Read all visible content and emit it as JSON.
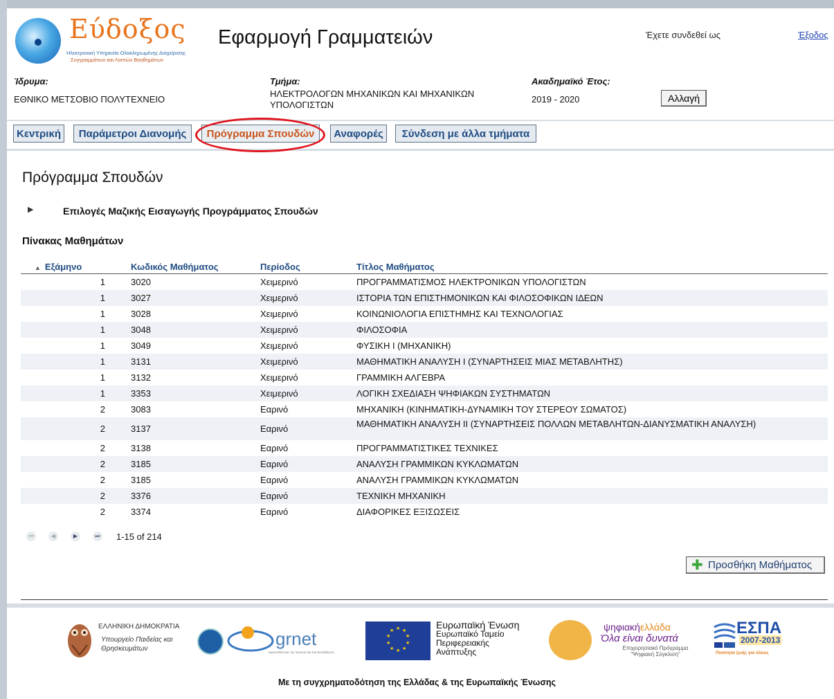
{
  "header": {
    "logo_name": "Εύδοξος",
    "logo_line1": "Ηλεκτρονική Υπηρεσία Ολοκληρωμένης Διαχείρισης",
    "logo_line2": "Συγγραμμάτων και Λοιπών Βοηθημάτων",
    "app_title": "Εφαρμογή Γραμματειών",
    "logged_in_as": "Έχετε συνδεθεί ως",
    "logout_link": "Έξοδος"
  },
  "info": {
    "institution_label": "Ίδρυμα:",
    "institution_value": "ΕΘΝΙΚΟ ΜΕΤΣΟΒΙΟ ΠΟΛΥΤΕΧΝΕΙΟ",
    "department_label": "Τμήμα:",
    "department_value": "ΗΛΕΚΤΡΟΛΟΓΩΝ ΜΗΧΑΝΙΚΩΝ ΚΑΙ ΜΗΧΑΝΙΚΩΝ ΥΠΟΛΟΓΙΣΤΩΝ",
    "year_label": "Ακαδημαϊκό Έτος:",
    "year_value": "2019 - 2020",
    "change_button": "Αλλαγή"
  },
  "tabs": [
    {
      "label": "Κεντρική",
      "active": false
    },
    {
      "label": "Παράμετροι Διανομής",
      "active": false
    },
    {
      "label": "Πρόγραμμα Σπουδών",
      "active": true
    },
    {
      "label": "Αναφορές",
      "active": false
    },
    {
      "label": "Σύνδεση με άλλα τμήματα",
      "active": false
    }
  ],
  "main": {
    "page_title": "Πρόγραμμα Σπουδών",
    "bulk_import_label": "Επιλογές Μαζικής Εισαγωγής Προγράμματος Σπουδών",
    "table_caption": "Πίνακας Μαθημάτων",
    "columns": [
      "Εξάμηνο",
      "Κωδικός Μαθήματος",
      "Περίοδος",
      "Τίτλος Μαθήματος"
    ],
    "rows": [
      {
        "semester": "1",
        "code": "3020",
        "period": "Χειμερινό",
        "title": "ΠΡΟΓΡΑΜΜΑΤΙΣΜΟΣ ΗΛΕΚΤΡΟΝΙΚΩΝ ΥΠΟΛΟΓΙΣΤΩΝ"
      },
      {
        "semester": "1",
        "code": "3027",
        "period": "Χειμερινό",
        "title": "ΙΣΤΟΡΙΑ ΤΩΝ ΕΠΙΣΤΗΜΟΝΙΚΩΝ ΚΑΙ ΦΙΛΟΣΟΦΙΚΩΝ ΙΔΕΩΝ"
      },
      {
        "semester": "1",
        "code": "3028",
        "period": "Χειμερινό",
        "title": "ΚΟΙΝΩΝΙΟΛΟΓΙΑ ΕΠΙΣΤΗΜΗΣ ΚΑΙ ΤΕΧΝΟΛΟΓΙΑΣ"
      },
      {
        "semester": "1",
        "code": "3048",
        "period": "Χειμερινό",
        "title": "ΦΙΛΟΣΟΦΙΑ"
      },
      {
        "semester": "1",
        "code": "3049",
        "period": "Χειμερινό",
        "title": "ΦΥΣΙΚΗ Ι (ΜΗΧΑΝΙΚΗ)"
      },
      {
        "semester": "1",
        "code": "3131",
        "period": "Χειμερινό",
        "title": "ΜΑΘΗΜΑΤΙΚΗ ΑΝΑΛΥΣΗ Ι (ΣΥΝΑΡΤΗΣΕΙΣ ΜΙΑΣ ΜΕΤΑΒΛΗΤΗΣ)"
      },
      {
        "semester": "1",
        "code": "3132",
        "period": "Χειμερινό",
        "title": "ΓΡΑΜΜΙΚΗ ΑΛΓΕΒΡΑ"
      },
      {
        "semester": "1",
        "code": "3353",
        "period": "Χειμερινό",
        "title": "ΛΟΓΙΚΗ ΣΧΕΔΙΑΣΗ ΨΗΦΙΑΚΩΝ ΣΥΣΤΗΜΑΤΩΝ"
      },
      {
        "semester": "2",
        "code": "3083",
        "period": "Εαρινό",
        "title": "ΜΗΧΑΝΙΚΗ (ΚΙΝΗΜΑΤΙΚΗ-ΔΥΝΑΜΙΚΗ ΤΟΥ ΣΤΕΡΕΟΥ ΣΩΜΑΤΟΣ)"
      },
      {
        "semester": "2",
        "code": "3137",
        "period": "Εαρινό",
        "title": "ΜΑΘΗΜΑΤΙΚΗ ΑΝΑΛΥΣΗ ΙΙ (ΣΥΝΑΡΤΗΣΕΙΣ ΠΟΛΛΩΝ ΜΕΤΑΒΛΗΤΩΝ-ΔΙΑΝΥΣΜΑΤΙΚΗ ΑΝΑΛΥΣΗ)"
      },
      {
        "semester": "2",
        "code": "3138",
        "period": "Εαρινό",
        "title": "ΠΡΟΓΡΑΜΜΑΤΙΣΤΙΚΕΣ ΤΕΧΝΙΚΕΣ"
      },
      {
        "semester": "2",
        "code": "3185",
        "period": "Εαρινό",
        "title": "ΑΝΑΛΥΣΗ ΓΡΑΜΜΙΚΩΝ ΚΥΚΛΩΜΑΤΩΝ"
      },
      {
        "semester": "2",
        "code": "3185",
        "period": "Εαρινό",
        "title": "ΑΝΑΛΥΣΗ ΓΡΑΜΜΙΚΩΝ ΚΥΚΛΩΜΑΤΩΝ"
      },
      {
        "semester": "2",
        "code": "3376",
        "period": "Εαρινό",
        "title": "ΤΕΧΝΙΚΗ ΜΗΧΑΝΙΚΗ"
      },
      {
        "semester": "2",
        "code": "3374",
        "period": "Εαρινό",
        "title": "ΔΙΑΦΟΡΙΚΕΣ ΕΞΙΣΩΣΕΙΣ"
      }
    ],
    "pager_text": "1-15 of 214",
    "add_button": "Προσθήκη Μαθήματος"
  },
  "footer": {
    "hellenic_republic": "ΕΛΛΗΝΙΚΗ ΔΗΜΟΚΡΑΤΙΑ",
    "ministry": "Υπουργείο Παιδείας και Θρησκευμάτων",
    "grnet": "grnet",
    "grnet_tagline": "Διασυνδέοντας την Έρευνα και την Εκπαίδευση",
    "eu_title": "Ευρωπαϊκή Ένωση",
    "eu_fund": "Ευρωπαϊκό Ταμείο Περιφερειακής Ανάπτυξης",
    "digital_prefix": "ψηφιακή",
    "digital_highlight": "ελλάδα",
    "digital_slogan": "Όλα είναι δυνατά",
    "digital_program": "Επιχειρησιακό Πρόγραμμα \"Ψηφιακή Σύγκλιση\"",
    "espa": "ΕΣΠΑ",
    "espa_years": "2007-2013",
    "espa_tagline": "Ποιότητα ζωής για όλους",
    "funding_note": "Με τη συγχρηματοδότηση της Ελλάδας & της Ευρωπαϊκής Ένωσης"
  },
  "colors": {
    "tab_text": "#1f4b82",
    "tab_active_text": "#c8551c",
    "highlight_ring": "#e0151f",
    "logo_orange": "#e8741c"
  }
}
